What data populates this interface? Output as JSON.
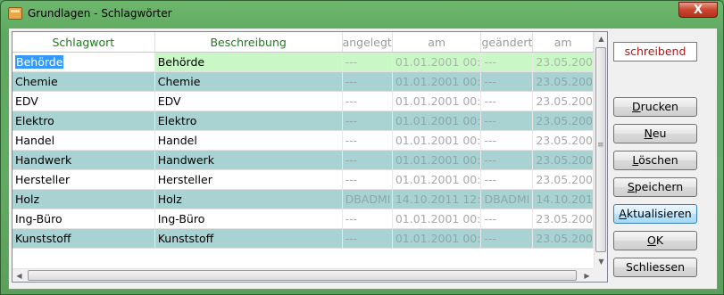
{
  "window": {
    "title": "Grundlagen - Schlagwörter",
    "close_label": "X"
  },
  "table": {
    "columns": [
      "Schlagwort",
      "Beschreibung",
      "angelegt",
      "am",
      "geändert",
      "am"
    ],
    "rows": [
      [
        "Behörde",
        "Behörde",
        "---",
        "01.01.2001 00:",
        "---",
        "23.05.200"
      ],
      [
        "Chemie",
        "Chemie",
        "---",
        "01.01.2001 00:",
        "---",
        "23.05.200"
      ],
      [
        "EDV",
        "EDV",
        "---",
        "01.01.2001 00:",
        "---",
        "23.05.200"
      ],
      [
        "Elektro",
        "Elektro",
        "---",
        "01.01.2001 00:",
        "---",
        "23.05.200"
      ],
      [
        "Handel",
        "Handel",
        "---",
        "01.01.2001 00:",
        "---",
        "23.05.200"
      ],
      [
        "Handwerk",
        "Handwerk",
        "---",
        "01.01.2001 00:",
        "---",
        "23.05.200"
      ],
      [
        "Hersteller",
        "Hersteller",
        "---",
        "01.01.2001 00:",
        "---",
        "23.05.200"
      ],
      [
        "Holz",
        "Holz",
        "DBADMI",
        "14.10.2011 12:",
        "DBADMI",
        "14.10.201"
      ],
      [
        "Ing-Büro",
        "Ing-Büro",
        "---",
        "01.01.2001 00:",
        "---",
        "23.05.200"
      ],
      [
        "Kunststoff",
        "Kunststoff",
        "---",
        "01.01.2001 00:",
        "---",
        "23.05.200"
      ]
    ]
  },
  "scroll": {
    "up": "▲",
    "down": "▼",
    "left": "◀",
    "right": "▶"
  },
  "status": "schreibend",
  "buttons": {
    "drucken": "Drucken",
    "neu": "Neu",
    "loeschen": "Löschen",
    "speichern": "Speichern",
    "aktualisieren": "Aktualisieren",
    "ok": "OK",
    "schliessen": "Schliessen"
  },
  "colors": {
    "row_teal": "#a9d3d3",
    "row_selected": "#c9f7c5",
    "header_green": "#1f7a1f",
    "status_red": "#b01515"
  }
}
